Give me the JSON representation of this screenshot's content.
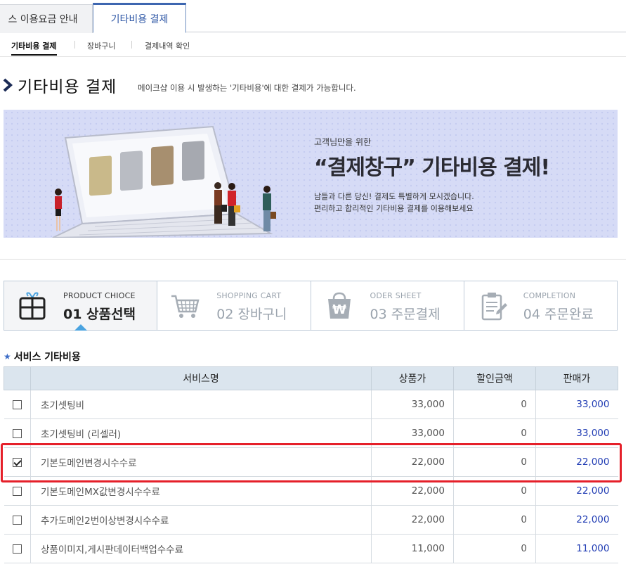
{
  "top_tabs": [
    {
      "label": "스 이용요금 안내"
    },
    {
      "label": "기타비용 결제"
    }
  ],
  "sub_tabs": [
    {
      "label": "기타비용 결제"
    },
    {
      "label": "장바구니"
    },
    {
      "label": "결제내역 확인"
    }
  ],
  "page": {
    "title": "기타비용 결제",
    "description": "메이크샵 이용 시 발생하는 '기타비용'에 대한 결제가 가능합니다."
  },
  "banner": {
    "subtitle": "고객님만을 위한",
    "title": "“결제창구” 기타비용 결제!",
    "desc1": "남들과 다른 당신! 결제도 특별하게 모시겠습니다.",
    "desc2": "편리하고 합리적인 기타비용 결제를 이용해보세요"
  },
  "steps": [
    {
      "en": "PRODUCT CHIOCE",
      "ko": "01 상품선택",
      "icon": "gift-box-icon",
      "active": true
    },
    {
      "en": "SHOPPING CART",
      "ko": "02 장바구니",
      "icon": "shopping-cart-icon",
      "active": false
    },
    {
      "en": "ODER SHEET",
      "ko": "03 주문결제",
      "icon": "won-bag-icon",
      "active": false
    },
    {
      "en": "COMPLETION",
      "ko": "04 주문완료",
      "icon": "clipboard-icon",
      "active": false
    }
  ],
  "section": {
    "title": "서비스 기타비용"
  },
  "table": {
    "headers": [
      "서비스명",
      "상품가",
      "할인금액",
      "판매가"
    ],
    "rows": [
      {
        "checked": false,
        "name": "초기셋팅비",
        "price": "33,000",
        "discount": "0",
        "sale": "33,000"
      },
      {
        "checked": false,
        "name": "초기셋팅비 (리셀러)",
        "price": "33,000",
        "discount": "0",
        "sale": "33,000"
      },
      {
        "checked": true,
        "name": "기본도메인변경시수수료",
        "price": "22,000",
        "discount": "0",
        "sale": "22,000"
      },
      {
        "checked": false,
        "name": "기본도메인MX값변경시수수료",
        "price": "22,000",
        "discount": "0",
        "sale": "22,000"
      },
      {
        "checked": false,
        "name": "추가도메인2번이상변경시수수료",
        "price": "22,000",
        "discount": "0",
        "sale": "22,000"
      },
      {
        "checked": false,
        "name": "상품이미지,게시판데이터백업수수료",
        "price": "11,000",
        "discount": "0",
        "sale": "11,000"
      }
    ]
  },
  "colors": {
    "accent": "#2e57a6",
    "sale_price": "#1f3bb3",
    "highlight": "#e5202a",
    "banner_bg": "#d6dbf6"
  }
}
